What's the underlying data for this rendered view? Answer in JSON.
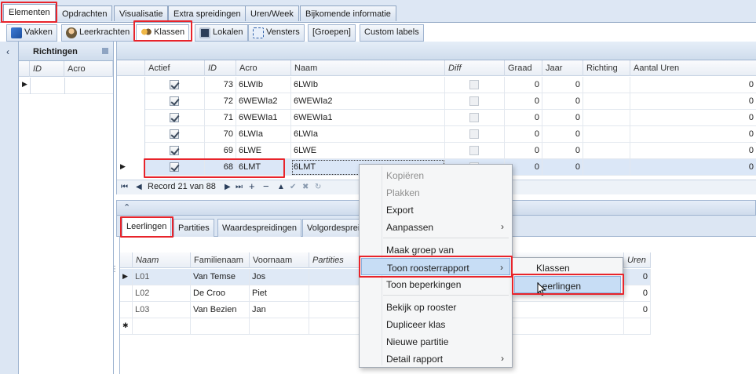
{
  "top_tabs": [
    "Elementen",
    "Opdrachten",
    "Visualisatie",
    "Extra spreidingen",
    "Uren/Week",
    "Bijkomende informatie"
  ],
  "sub_tabs": [
    "Vakken",
    "Leerkrachten",
    "Klassen",
    "Lokalen",
    "Vensters",
    "[Groepen]",
    "Custom labels"
  ],
  "left_panel": {
    "title": "Richtingen",
    "columns": [
      "ID",
      "Acro"
    ],
    "collapse_glyph": "‹"
  },
  "klassen_grid": {
    "columns": [
      "Actief",
      "ID",
      "Acro",
      "Naam",
      "Diff",
      "Graad",
      "Jaar",
      "Richting",
      "Aantal Uren"
    ],
    "rows": [
      {
        "actief": true,
        "id": "73",
        "acro": "6LWIb",
        "naam": "6LWIb",
        "graad": "0",
        "jaar": "0",
        "uren": "0"
      },
      {
        "actief": true,
        "id": "72",
        "acro": "6WEWIa2",
        "naam": "6WEWIa2",
        "graad": "0",
        "jaar": "0",
        "uren": "0"
      },
      {
        "actief": true,
        "id": "71",
        "acro": "6WEWIa1",
        "naam": "6WEWIa1",
        "graad": "0",
        "jaar": "0",
        "uren": "0"
      },
      {
        "actief": true,
        "id": "70",
        "acro": "6LWIa",
        "naam": "6LWIa",
        "graad": "0",
        "jaar": "0",
        "uren": "0"
      },
      {
        "actief": true,
        "id": "69",
        "acro": "6LWE",
        "naam": "6LWE",
        "graad": "0",
        "jaar": "0",
        "uren": "0"
      },
      {
        "actief": true,
        "id": "68",
        "acro": "6LMT",
        "naam": "6LMT",
        "graad": "0",
        "jaar": "0",
        "uren": "0"
      }
    ],
    "record_text": "Record 21 van 88"
  },
  "detail_tabs": [
    "Leerlingen",
    "Partities",
    "Waardespreidingen",
    "Volgordespreidingen"
  ],
  "leerlingen_grid": {
    "columns": [
      "Naam",
      "Familienaam",
      "Voornaam",
      "Partities",
      "Uren"
    ],
    "rows": [
      {
        "naam": "L01",
        "familienaam": "Van Temse",
        "voornaam": "Jos",
        "uren": "0"
      },
      {
        "naam": "L02",
        "familienaam": "De Croo",
        "voornaam": "Piet",
        "uren": "0"
      },
      {
        "naam": "L03",
        "familienaam": "Van Bezien",
        "voornaam": "Jan",
        "uren": "0"
      }
    ],
    "new_row_glyph": "✱"
  },
  "context_menu": {
    "items": [
      "Kopiëren",
      "Plakken",
      "Export",
      "Aanpassen",
      "Maak groep van",
      "Toon roosterrapport",
      "Toon beperkingen",
      "Bekijk op rooster",
      "Dupliceer klas",
      "Nieuwe partitie",
      "Detail rapport"
    ],
    "submenu_arrow": "›"
  },
  "submenu": {
    "items": [
      "Klassen",
      "Leerlingen"
    ]
  },
  "nav_glyphs": {
    "first": "⏮",
    "prev": "◀",
    "next": "▶",
    "next_page": "⏭",
    "last": "▶|",
    "add": "+",
    "remove": "−",
    "up": "▲",
    "accept": "✔",
    "cancel": "✖",
    "refresh": "↻"
  },
  "colors": {
    "highlight_red": "#e8242b",
    "selection_blue": "#c7ddf5"
  }
}
